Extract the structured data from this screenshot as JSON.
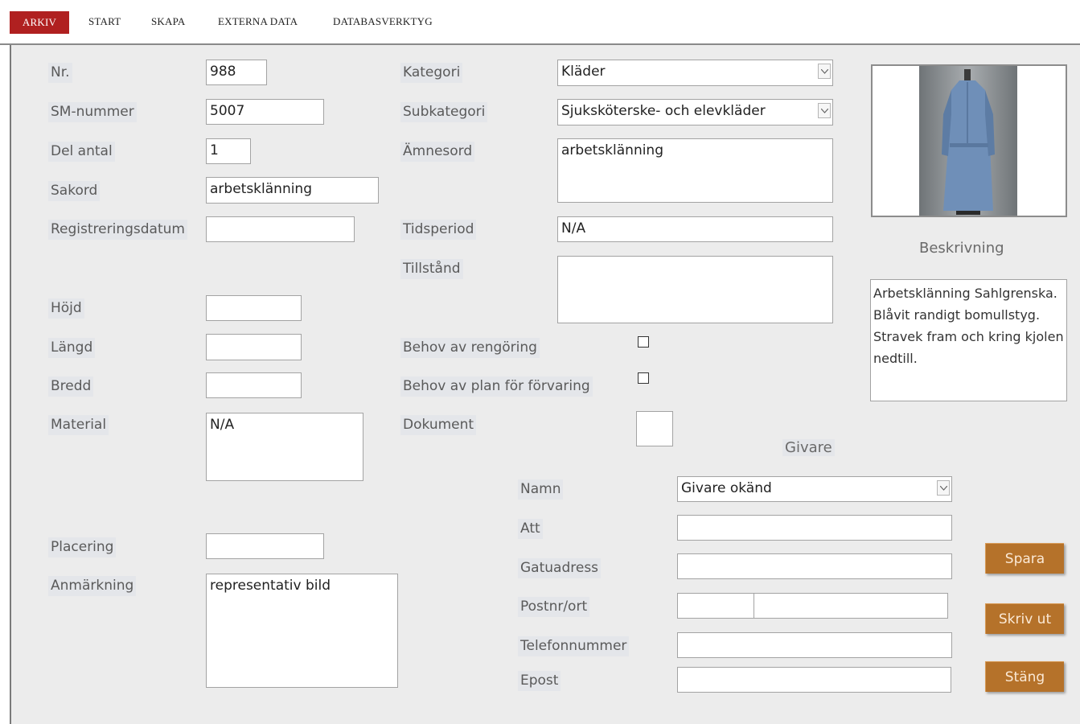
{
  "ribbon": {
    "tabs": [
      "ARKIV",
      "START",
      "SKAPA",
      "EXTERNA DATA",
      "DATABASVERKTYG"
    ]
  },
  "colors": {
    "active_tab": "#b02020",
    "button": "#b5722a",
    "label_bg": "#e4e6ea",
    "form_bg": "#ececec"
  },
  "left": {
    "nr_label": "Nr.",
    "nr_value": "988",
    "sm_label": "SM-nummer",
    "sm_value": "5007",
    "del_label": "Del antal",
    "del_value": "1",
    "sakord_label": "Sakord",
    "sakord_value": "arbetsklänning",
    "regdatum_label": "Registreringsdatum",
    "regdatum_value": "",
    "hojd_label": "Höjd",
    "hojd_value": "",
    "langd_label": "Längd",
    "langd_value": "",
    "bredd_label": "Bredd",
    "bredd_value": "",
    "material_label": "Material",
    "material_value": "N/A",
    "placering_label": "Placering",
    "placering_value": "",
    "anmarkning_label": "Anmärkning",
    "anmarkning_value": "representativ bild"
  },
  "middle": {
    "kategori_label": "Kategori",
    "kategori_value": "Kläder",
    "subkategori_label": "Subkategori",
    "subkategori_value": "Sjuksköterske- och elevkläder",
    "amnesord_label": "Ämnesord",
    "amnesord_value": "arbetsklänning",
    "tidsperiod_label": "Tidsperiod",
    "tidsperiod_value": "N/A",
    "tillstand_label": "Tillstånd",
    "tillstand_value": "",
    "rengoring_label": "Behov av rengöring",
    "forvaring_label": "Behov av plan för förvaring",
    "dokument_label": "Dokument"
  },
  "right": {
    "beskrivning_label": "Beskrivning",
    "beskrivning_value": "Arbetsklänning Sahlgrenska. Blåvit randigt bomullstyg. Stravek fram och kring kjolen nedtill.",
    "photo_icon": "dress-photo"
  },
  "givare": {
    "heading": "Givare",
    "namn_label": "Namn",
    "namn_value": "Givare okänd",
    "att_label": "Att",
    "att_value": "",
    "gatuadress_label": "Gatuadress",
    "gatuadress_value": "",
    "postnr_label": "Postnr/ort",
    "postnr_value": "",
    "ort_value": "",
    "telefon_label": "Telefonnummer",
    "telefon_value": "",
    "epost_label": "Epost",
    "epost_value": ""
  },
  "buttons": {
    "spara": "Spara",
    "skriv_ut": "Skriv ut",
    "stang": "Stäng"
  }
}
